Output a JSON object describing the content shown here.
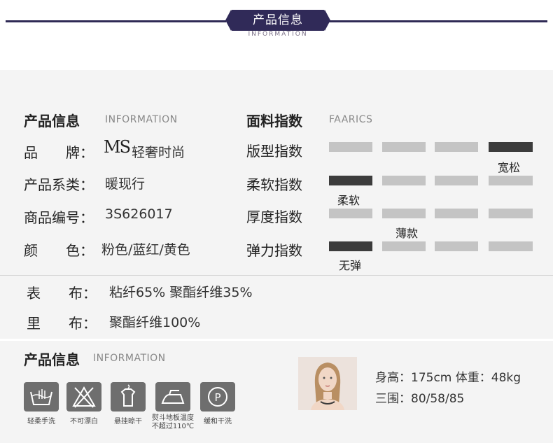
{
  "header": {
    "title": "产品信息",
    "subtitle": "INFORMATION"
  },
  "info": {
    "title": "产品信息",
    "title_en": "INFORMATION",
    "rows": [
      {
        "label": "品　　牌：",
        "value": "轻奢时尚",
        "logo": "MS"
      },
      {
        "label": "产品系类：",
        "value": "暖现行"
      },
      {
        "label": "商品编号：",
        "value": "3S626017"
      },
      {
        "label": "颜　　色：",
        "value": "粉色/蓝红/黄色"
      }
    ]
  },
  "fabric_index": {
    "title": "面料指数",
    "title_en": "FAARICS",
    "rows": [
      {
        "label": "版型指数",
        "active": 4,
        "tag": "宽松"
      },
      {
        "label": "柔软指数",
        "active": 1,
        "tag": "柔软"
      },
      {
        "label": "厚度指数",
        "active": 0,
        "tag": "薄款"
      },
      {
        "label": "弹力指数",
        "active": 1,
        "tag": "无弹"
      }
    ]
  },
  "materials": [
    {
      "label": "表　　布：",
      "value": "粘纤65% 聚酯纤维35%"
    },
    {
      "label": "里　　布：",
      "value": "聚酯纤维100%"
    }
  ],
  "care": {
    "title": "产品信息",
    "title_en": "INFORMATION",
    "items": [
      {
        "icon": "hand-wash-icon",
        "label": "轻柔手洗"
      },
      {
        "icon": "no-bleach-icon",
        "label": "不可漂白"
      },
      {
        "icon": "hang-dry-icon",
        "label": "悬挂晾干"
      },
      {
        "icon": "iron-icon",
        "label": "熨斗地板温度",
        "label2": "不超过110℃"
      },
      {
        "icon": "dry-clean-icon",
        "label": "缓和干洗"
      }
    ]
  },
  "model": {
    "height_line": "身高：175cm  体重：48kg",
    "measure_line": "三围：80/58/85"
  }
}
